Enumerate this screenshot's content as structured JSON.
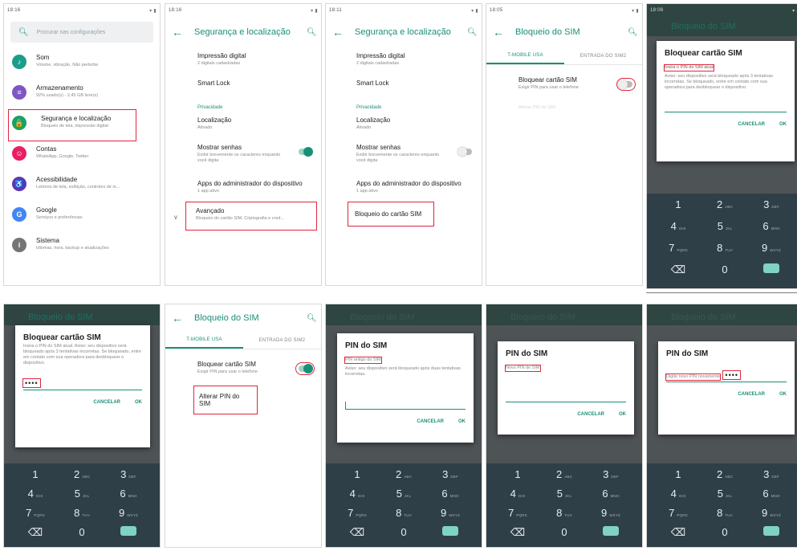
{
  "panel1": {
    "time": "18:16",
    "search_placeholder": "Procurar nas configurações",
    "items": [
      {
        "title": "Som",
        "sub": "Volume, vibração, Não perturbe",
        "color": "#1a9e8a",
        "icon": "♪"
      },
      {
        "title": "Armazenamento",
        "sub": "92% usado(s) - 2,45 GB livre(s)",
        "color": "#7e57c2",
        "icon": "≡"
      },
      {
        "title": "Segurança e localização",
        "sub": "Bloqueio de tela, impressão digital",
        "color": "#1aa260",
        "icon": "🔒"
      },
      {
        "title": "Contas",
        "sub": "WhatsApp, Google, Twitter",
        "color": "#e91e63",
        "icon": "☺"
      },
      {
        "title": "Acessibilidade",
        "sub": "Leitores de tela, exibição, controles de in...",
        "color": "#5e35b1",
        "icon": "♿"
      },
      {
        "title": "Google",
        "sub": "Serviços e preferências",
        "color": "#4285f4",
        "icon": "G"
      },
      {
        "title": "Sistema",
        "sub": "Idiomas, hora, backup e atualizações",
        "color": "#757575",
        "icon": "i"
      }
    ]
  },
  "panel2": {
    "time": "18:16",
    "title": "Segurança e localização",
    "item_fingerprint": "Impressão digital",
    "item_fingerprint_sub": "2 digitais cadastradas",
    "item_smartlock": "Smart Lock",
    "section_privacy": "Privacidade",
    "item_location": "Localização",
    "item_location_sub": "Ativado",
    "item_passwords": "Mostrar senhas",
    "item_passwords_sub": "Exibir brevemente os caracteres enquanto você digita",
    "item_admin": "Apps do administrador do dispositivo",
    "item_admin_sub": "1 app ativo",
    "item_advanced": "Avançado",
    "item_advanced_sub": "Bloqueio do cartão SIM, Criptografia e cred..."
  },
  "panel3": {
    "time": "18:11",
    "title": "Segurança e localização",
    "item_simlock": "Bloqueio do cartão SIM"
  },
  "panel4": {
    "time": "18:05",
    "title": "Bloqueio do SIM",
    "tab1": "T-MOBILE USA",
    "tab2": "ENTRADA DO SIM2",
    "lock_title": "Bloquear cartão SIM",
    "lock_sub": "Exigir PIN para usar o telefone",
    "change_pin": "Alterar PIN do SIM"
  },
  "panel5": {
    "time": "18:06",
    "bg_title": "Bloqueio do SIM",
    "dialog_title": "Bloquear cartão SIM",
    "dialog_hint": "Insira o PIN do SIM atual",
    "dialog_body": "Aviso: seu dispositivo será bloqueado após 3 tentativas incorretas. Se bloqueado, entre em contato com sua operadora para desbloquear o dispositivo.",
    "cancel": "CANCELAR",
    "ok": "OK"
  },
  "panel6": {
    "bg_title": "Bloqueio do SIM",
    "dialog_title": "Bloquear cartão SIM",
    "dialog_body": "Insira o PIN do SIM atual. Aviso: seu dispositivo será bloqueado após 3 tentativas incorretas. Se bloqueado, entre em contato com sua operadora para desbloquear o dispositivo.",
    "pin_dots": "••••",
    "cancel": "CANCELAR",
    "ok": "OK"
  },
  "panel8": {
    "bg_title": "Bloqueio do SIM",
    "dialog_title": "PIN do SIM",
    "dialog_hint": "PIN antigo do SIM",
    "dialog_body": "Aviso: seu dispositivo será bloqueado após duas tentativas incorretas.",
    "cancel": "CANCELAR",
    "ok": "OK"
  },
  "panel9": {
    "bg_title": "Bloqueio do SIM",
    "dialog_title": "PIN do SIM",
    "dialog_hint": "Novo PIN do SIM",
    "cancel": "CANCELAR",
    "ok": "OK"
  },
  "panel10": {
    "bg_title": "Bloqueio do SIM",
    "dialog_title": "PIN do SIM",
    "dialog_hint": "Digite novo PIN novamente",
    "pin_dots": "••••",
    "cancel": "CANCELAR",
    "ok": "OK"
  },
  "keypad": {
    "keys": [
      {
        "n": "1",
        "l": ""
      },
      {
        "n": "2",
        "l": "ABC"
      },
      {
        "n": "3",
        "l": "DEF"
      },
      {
        "n": "4",
        "l": "GHI"
      },
      {
        "n": "5",
        "l": "JKL"
      },
      {
        "n": "6",
        "l": "MNO"
      },
      {
        "n": "7",
        "l": "PQRS"
      },
      {
        "n": "8",
        "l": "TUV"
      },
      {
        "n": "9",
        "l": "WXYZ"
      },
      {
        "n": "⌫",
        "l": ""
      },
      {
        "n": "0",
        "l": ""
      },
      {
        "n": "",
        "l": ""
      }
    ]
  }
}
